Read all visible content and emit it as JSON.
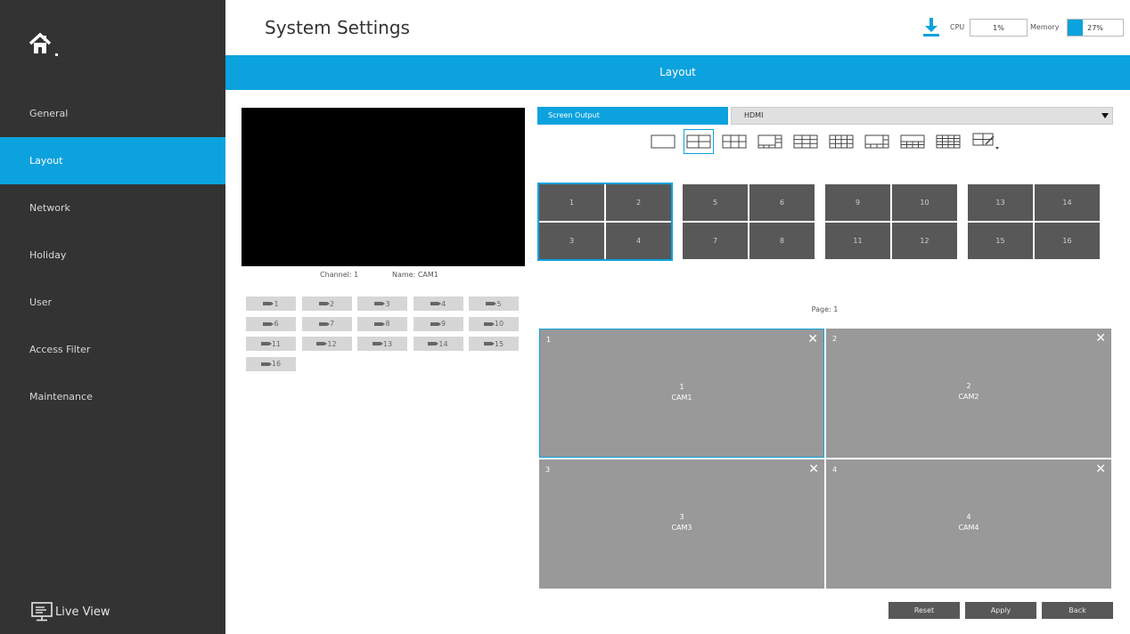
{
  "sidebar": {
    "items": [
      {
        "label": "General"
      },
      {
        "label": "Layout"
      },
      {
        "label": "Network"
      },
      {
        "label": "Holiday"
      },
      {
        "label": "User"
      },
      {
        "label": "Access Filter"
      },
      {
        "label": "Maintenance"
      }
    ],
    "active": "Layout",
    "live_view": "Live View"
  },
  "header": {
    "title": "System Settings",
    "cpu_label": "CPU",
    "cpu_value": "1%",
    "memory_label": "Memory",
    "memory_value": "27%",
    "memory_fraction": 0.27
  },
  "section_title": "Layout",
  "preview": {
    "channel_text": "Channel: 1",
    "name_text": "Name: CAM1"
  },
  "channels": [
    "1",
    "2",
    "3",
    "4",
    "5",
    "6",
    "7",
    "8",
    "9",
    "10",
    "11",
    "12",
    "13",
    "14",
    "15",
    "16"
  ],
  "screen_output": {
    "label": "Screen Output",
    "value": "HDMI"
  },
  "layout_options": [
    "1-split",
    "4-split",
    "6-split",
    "8-split",
    "9-split",
    "13-split",
    "16-split",
    "25-split",
    "36-split",
    "custom"
  ],
  "groups": [
    [
      "1",
      "2",
      "3",
      "4"
    ],
    [
      "5",
      "6",
      "7",
      "8"
    ],
    [
      "9",
      "10",
      "11",
      "12"
    ],
    [
      "13",
      "14",
      "15",
      "16"
    ]
  ],
  "page_label": "Page: 1",
  "panes": [
    {
      "num": "1",
      "channel": "1",
      "name": "CAM1"
    },
    {
      "num": "2",
      "channel": "2",
      "name": "CAM2"
    },
    {
      "num": "3",
      "channel": "3",
      "name": "CAM3"
    },
    {
      "num": "4",
      "channel": "4",
      "name": "CAM4"
    }
  ],
  "close_glyph": "✕",
  "buttons": {
    "reset": "Reset",
    "apply": "Apply",
    "back": "Back"
  },
  "colors": {
    "accent": "#0ca2dd",
    "sidebar": "#333333",
    "cell": "#585858",
    "pane": "#999999"
  }
}
